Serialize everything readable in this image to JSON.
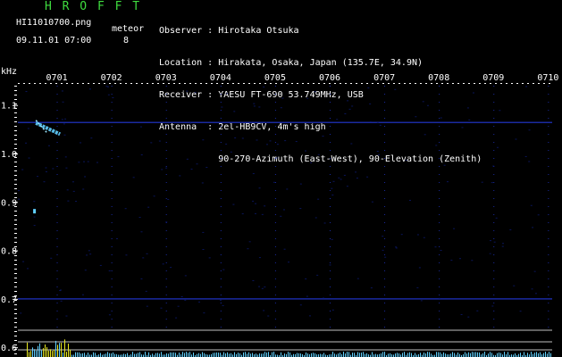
{
  "header": {
    "app_title": "H R O F F T",
    "filename": "HI11010700.png",
    "meteor_label": "meteor",
    "datetime": "09.11.01 07:00",
    "meteor_count": "8",
    "info_lines": [
      "Observer : Hirotaka Otsuka",
      "Location : Hirakata, Osaka, Japan (135.7E, 34.9N)",
      "Receiver : YAESU FT-690 53.749MHz, USB",
      "Antenna  : 2el-HB9CV, 4m's high",
      "           90-270-Azimuth (East-West), 90-Elevation (Zenith)"
    ]
  },
  "colors": {
    "title_green": "#3fdc3f",
    "grid_blue": "#1a2aa0",
    "axis_white": "#ffffff",
    "echo_cyan": "#60d0ff",
    "bar_yellow": "#e8e820"
  },
  "chart_data": {
    "type": "heatmap",
    "ylabel": "kHz",
    "x_ticks": [
      "0701",
      "0702",
      "0703",
      "0704",
      "0705",
      "0706",
      "0707",
      "0708",
      "0709",
      "0710"
    ],
    "y_ticks": [
      "1.1",
      "1.0",
      "0.9",
      "0.8",
      "0.7",
      "0.6"
    ],
    "y_range": [
      0.58,
      1.14
    ],
    "x_range_minutes": [
      0,
      10
    ],
    "carrier_lines_khz": [
      1.064,
      0.7
    ],
    "echoes": [
      {
        "minute": 0.65,
        "khz_start": 1.063,
        "khz_end": 1.04,
        "duration_min": 0.45
      },
      {
        "minute": 0.6,
        "khz_start": 0.88,
        "khz_end": 0.88,
        "duration_min": 0.05
      }
    ]
  }
}
